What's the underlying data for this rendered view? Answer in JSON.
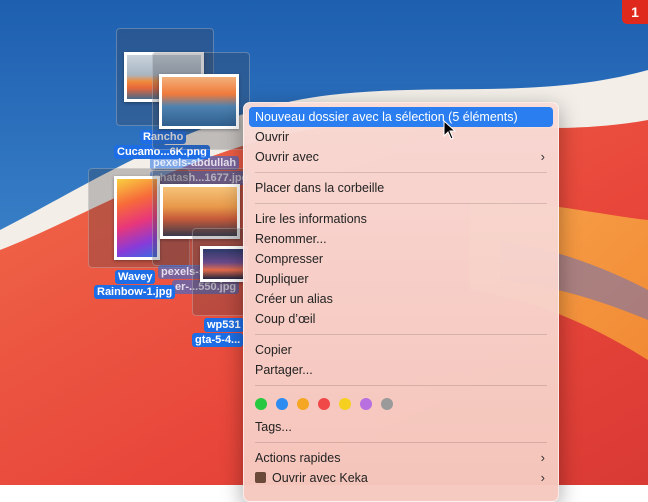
{
  "badge": {
    "count": "1"
  },
  "desktop": {
    "files": [
      {
        "label_line1": "Rancho",
        "label_line2": "Cucamo...6K.png"
      },
      {
        "label_line1": "pexels-abdullah",
        "label_line2": "ghatash...1677.jpg"
      },
      {
        "label_line1": "Wavey",
        "label_line2": "Rainbow-1.jpg"
      },
      {
        "label_line1": "pexels-s",
        "label_line2": "er-...550.jpg"
      },
      {
        "label_line1": "wp531",
        "label_line2": "gta-5-4..."
      }
    ]
  },
  "menu": {
    "items": [
      {
        "label": "Nouveau dossier avec la sélection (5 éléments)"
      },
      {
        "label": "Ouvrir"
      },
      {
        "label": "Ouvrir avec"
      },
      {
        "label": "Placer dans la corbeille"
      },
      {
        "label": "Lire les informations"
      },
      {
        "label": "Renommer..."
      },
      {
        "label": "Compresser"
      },
      {
        "label": "Dupliquer"
      },
      {
        "label": "Créer un alias"
      },
      {
        "label": "Coup d’œil"
      },
      {
        "label": "Copier"
      },
      {
        "label": "Partager..."
      },
      {
        "label": "Tags..."
      },
      {
        "label": "Actions rapides"
      },
      {
        "label": "Ouvrir avec Keka"
      }
    ],
    "tag_colors": [
      "#28c840",
      "#2e8cf0",
      "#f5a623",
      "#f04848",
      "#f5d020",
      "#b86fe0",
      "#9a9a9a"
    ],
    "highlight_color": "#2b7ef0"
  }
}
